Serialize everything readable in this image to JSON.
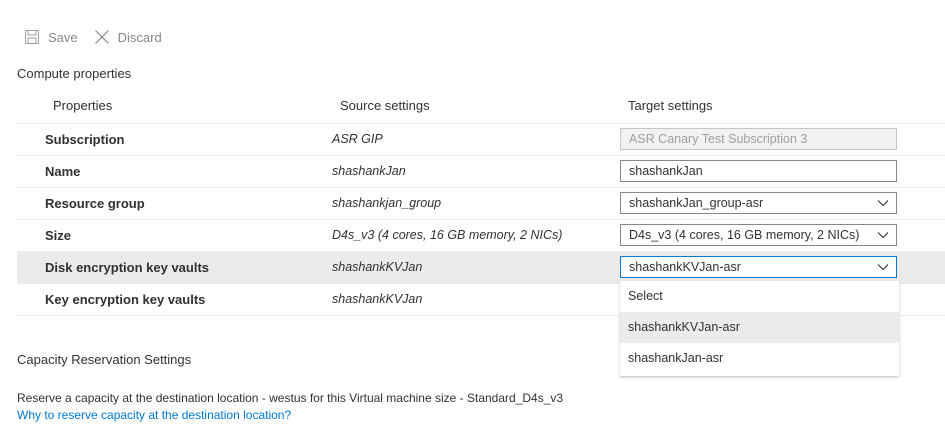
{
  "toolbar": {
    "save_label": "Save",
    "save_icon": "save-icon",
    "discard_label": "Discard",
    "discard_icon": "close-icon"
  },
  "compute_section": {
    "title": "Compute properties",
    "columns": {
      "properties": "Properties",
      "source": "Source settings",
      "target": "Target settings"
    },
    "rows": [
      {
        "label": "Subscription",
        "source": "ASR GIP",
        "target": "ASR Canary Test Subscription 3",
        "control": "text-disabled"
      },
      {
        "label": "Name",
        "source": "shashankJan",
        "target": "shashankJan",
        "control": "text"
      },
      {
        "label": "Resource group",
        "source": "shashankjan_group",
        "target": "shashankJan_group-asr",
        "control": "dropdown"
      },
      {
        "label": "Size",
        "source": "D4s_v3 (4 cores, 16 GB memory, 2 NICs)",
        "target": "D4s_v3 (4 cores, 16 GB memory, 2 NICs)",
        "control": "dropdown"
      },
      {
        "label": "Disk encryption key vaults",
        "source": "shashankKVJan",
        "target": "shashankKVJan-asr",
        "control": "dropdown-open"
      },
      {
        "label": "Key encryption key vaults",
        "source": "shashankKVJan",
        "target": "",
        "control": "none"
      }
    ]
  },
  "dropdown_options": [
    {
      "label": "Select",
      "hovered": false
    },
    {
      "label": "shashankKVJan-asr",
      "hovered": true
    },
    {
      "label": "shashankJan-asr",
      "hovered": false
    }
  ],
  "capacity_section": {
    "title": "Capacity Reservation Settings",
    "description": "Reserve a capacity at the destination location - westus for this Virtual machine size - Standard_D4s_v3",
    "link": "Why to reserve capacity at the destination location?"
  },
  "colors": {
    "accent": "#0078d4",
    "selected_row": "#edebe9",
    "disabled_text": "#8a8886"
  }
}
